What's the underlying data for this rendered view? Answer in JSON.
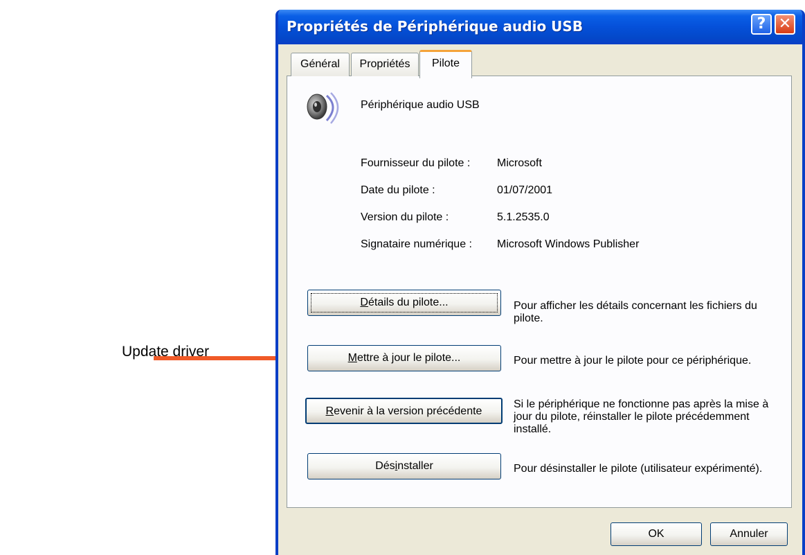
{
  "annotation": {
    "label": "Update driver",
    "arrow_color": "#f05a28"
  },
  "window": {
    "title": "Propriétés de Périphérique audio USB",
    "help_glyph": "?",
    "close_glyph": "✕"
  },
  "tabs": [
    {
      "label": "Général",
      "active": false
    },
    {
      "label": "Propriétés",
      "active": false
    },
    {
      "label": "Pilote",
      "active": true
    }
  ],
  "device": {
    "icon": "speaker-icon",
    "name": "Périphérique audio USB"
  },
  "driver_info": [
    {
      "label": "Fournisseur du pilote :",
      "value": "Microsoft"
    },
    {
      "label": "Date du pilote :",
      "value": "01/07/2001"
    },
    {
      "label": "Version du pilote :",
      "value": "5.1.2535.0"
    },
    {
      "label": "Signataire numérique :",
      "value": "Microsoft Windows Publisher"
    }
  ],
  "actions": {
    "details": {
      "pre": "",
      "accel": "D",
      "post": "étails du pilote...",
      "description": "Pour afficher les détails concernant les fichiers du pilote."
    },
    "update": {
      "pre": "",
      "accel": "M",
      "post": "ettre à jour le pilote...",
      "description": "Pour mettre à jour le pilote pour ce périphérique."
    },
    "rollback": {
      "pre": "",
      "accel": "R",
      "post": "evenir à la version précédente",
      "description": "Si le périphérique ne fonctionne pas après la mise à jour du pilote, réinstaller le pilote précédemment installé."
    },
    "uninstall": {
      "pre": "Dés",
      "accel": "i",
      "post": "nstaller",
      "description": "Pour désinstaller le pilote (utilisateur expérimenté)."
    }
  },
  "footer": {
    "ok": "OK",
    "cancel": "Annuler"
  },
  "colors": {
    "titlebar": "#0550d9",
    "window_bg": "#ece9d8",
    "active_tab_accent": "#f5a33a",
    "close_button": "#d93c14"
  }
}
